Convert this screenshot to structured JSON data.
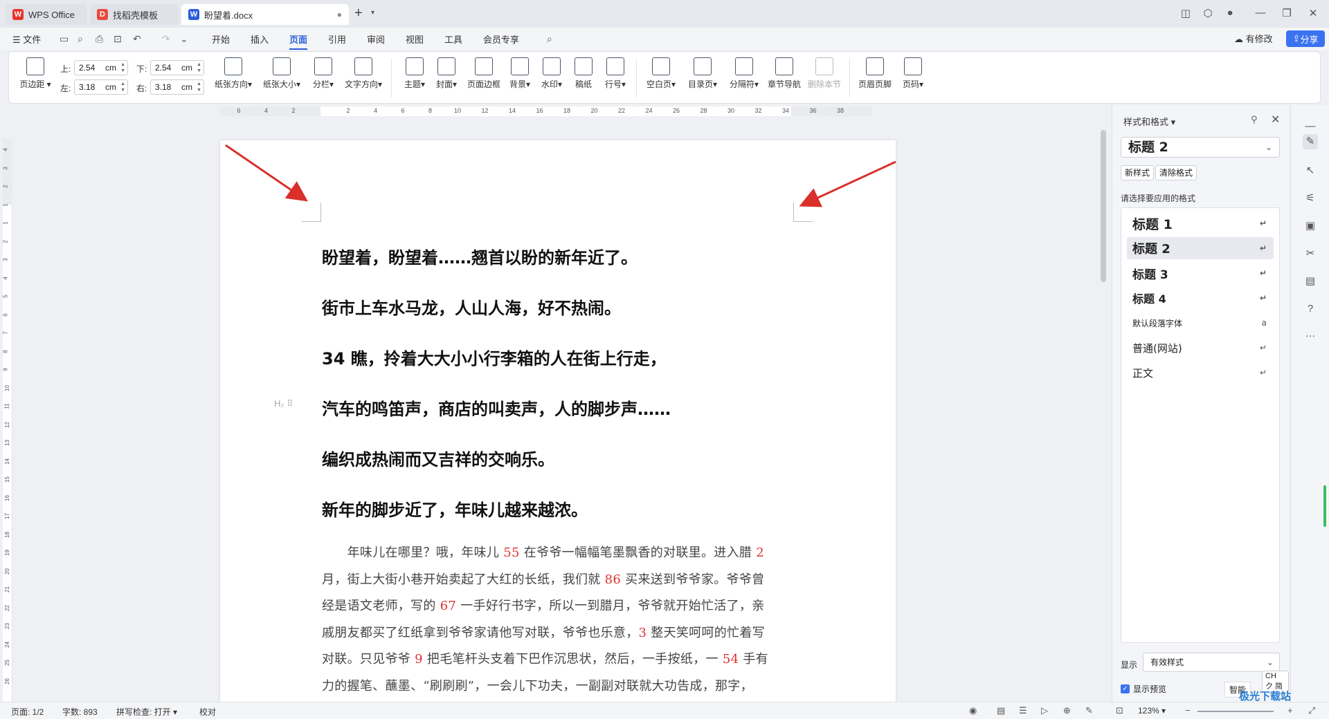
{
  "tabs": [
    {
      "label": "WPS Office",
      "icon": "wps-logo-icon"
    },
    {
      "label": "找稻壳模板",
      "icon": "docer-icon"
    },
    {
      "label": "盼望着.docx",
      "icon": "word-doc-icon",
      "active": true
    }
  ],
  "menu": {
    "file": "文件",
    "items": [
      "开始",
      "插入",
      "页面",
      "引用",
      "审阅",
      "视图",
      "工具",
      "会员专享"
    ],
    "active": "页面",
    "modified": "有修改",
    "share": "分享"
  },
  "ribbon": {
    "margin_button": "页边距",
    "margins": {
      "top_label": "上:",
      "top_value": "2.54",
      "bottom_label": "下:",
      "bottom_value": "2.54",
      "left_label": "左:",
      "left_value": "3.18",
      "right_label": "右:",
      "right_value": "3.18",
      "unit": "cm"
    },
    "groups1": [
      "纸张方向",
      "纸张大小",
      "分栏",
      "文字方向"
    ],
    "groups2": [
      "主题",
      "封面",
      "页面边框",
      "背景",
      "水印",
      "稿纸",
      "行号"
    ],
    "groups3": [
      "空白页",
      "目录页",
      "分隔符",
      "章节导航",
      "删除本节"
    ],
    "groups4": [
      "页眉页脚",
      "页码"
    ]
  },
  "ruler": {
    "h_ticks": [
      "6",
      "4",
      "2",
      "2",
      "4",
      "6",
      "8",
      "10",
      "12",
      "14",
      "16",
      "18",
      "20",
      "22",
      "24",
      "26",
      "28",
      "30",
      "32",
      "34",
      "36",
      "38"
    ],
    "v_ticks": [
      "4",
      "3",
      "2",
      "1",
      "1",
      "2",
      "3",
      "4",
      "5",
      "6",
      "7",
      "8",
      "9",
      "10",
      "11",
      "12",
      "13",
      "14",
      "15",
      "16",
      "17",
      "18",
      "19",
      "20",
      "21",
      "22",
      "23",
      "24",
      "25",
      "26"
    ]
  },
  "document": {
    "heading_marker": "H₂ ⠿",
    "headings": [
      "盼望着，盼望着……翘首以盼的新年近了。",
      "街市上车水马龙，人山人海，好不热闹。",
      "34 瞧，拎着大大小小行李箱的人在街上行走，",
      "汽车的鸣笛声，商店的叫卖声，人的脚步声……",
      "编织成热闹而又吉祥的交响乐。",
      "新年的脚步近了，年味儿越来越浓。"
    ],
    "body_lines": [
      [
        {
          "t": "　　年味儿在哪里？哦，年味儿 "
        },
        {
          "t": "55",
          "n": 1
        },
        {
          "t": " 在爷爷一幅幅笔墨飘香的对联里。进入腊 "
        },
        {
          "t": "2",
          "n": 1
        }
      ],
      [
        {
          "t": "月，街上大街小巷开始卖起了大红的长纸，我们就 "
        },
        {
          "t": "86",
          "n": 1
        },
        {
          "t": " 买来送到爷爷家。爷爷曾"
        }
      ],
      [
        {
          "t": "经是语文老师，写的 "
        },
        {
          "t": "67",
          "n": 1
        },
        {
          "t": " 一手好行书字，所以一到腊月，爷爷就开始忙活了，亲"
        }
      ],
      [
        {
          "t": "戚朋友都买了红纸拿到爷爷家请他写对联，爷爷也乐意，"
        },
        {
          "t": "3",
          "n": 1
        },
        {
          "t": " 整天笑呵呵的忙着写"
        }
      ],
      [
        {
          "t": "对联。只见爷爷 "
        },
        {
          "t": "9",
          "n": 1
        },
        {
          "t": " 把毛笔杆头支着下巴作沉思状，然后，一手按纸，一 "
        },
        {
          "t": "54",
          "n": 1
        },
        {
          "t": " 手有"
        }
      ],
      [
        {
          "t": "力的握笔、蘸墨、“刷刷刷”，一会儿下功夫，一副副对联就大功告成，那字，"
        }
      ]
    ]
  },
  "styles_panel": {
    "title": "样式和格式",
    "current": "标题  2",
    "new_style": "新样式",
    "clear_format": "清除格式",
    "hint": "请选择要应用的格式",
    "items": [
      {
        "label": "标题  1",
        "weight": "bold",
        "size": 19,
        "mark": "↵"
      },
      {
        "label": "标题  2",
        "weight": "bold",
        "size": 18,
        "mark": "↵",
        "selected": true
      },
      {
        "label": "标题  3",
        "weight": "bold",
        "size": 17,
        "mark": "↵"
      },
      {
        "label": "标题  4",
        "weight": "bold",
        "size": 16,
        "mark": "↵"
      },
      {
        "label": "默认段落字体",
        "weight": "normal",
        "size": 12,
        "mark": "a"
      },
      {
        "label": "普通(网站)",
        "weight": "normal",
        "size": 15,
        "mark": "↵"
      },
      {
        "label": "正文",
        "weight": "normal",
        "size": 15,
        "mark": "↵"
      }
    ],
    "show_label": "显示",
    "show_value": "有效样式",
    "preview": "显示预览",
    "smart": "智能",
    "ime": "CH ク 简"
  },
  "status": {
    "page": "页面: 1/2",
    "words": "字数: 893",
    "spell": "拼写检查: 打开",
    "proof": "校对",
    "zoom": "123%"
  },
  "watermark": "极光下载站",
  "colors": {
    "accent": "#2b5fd9",
    "share": "#3b72f0",
    "number_red": "#e03030",
    "arrow": "#d9302a"
  }
}
